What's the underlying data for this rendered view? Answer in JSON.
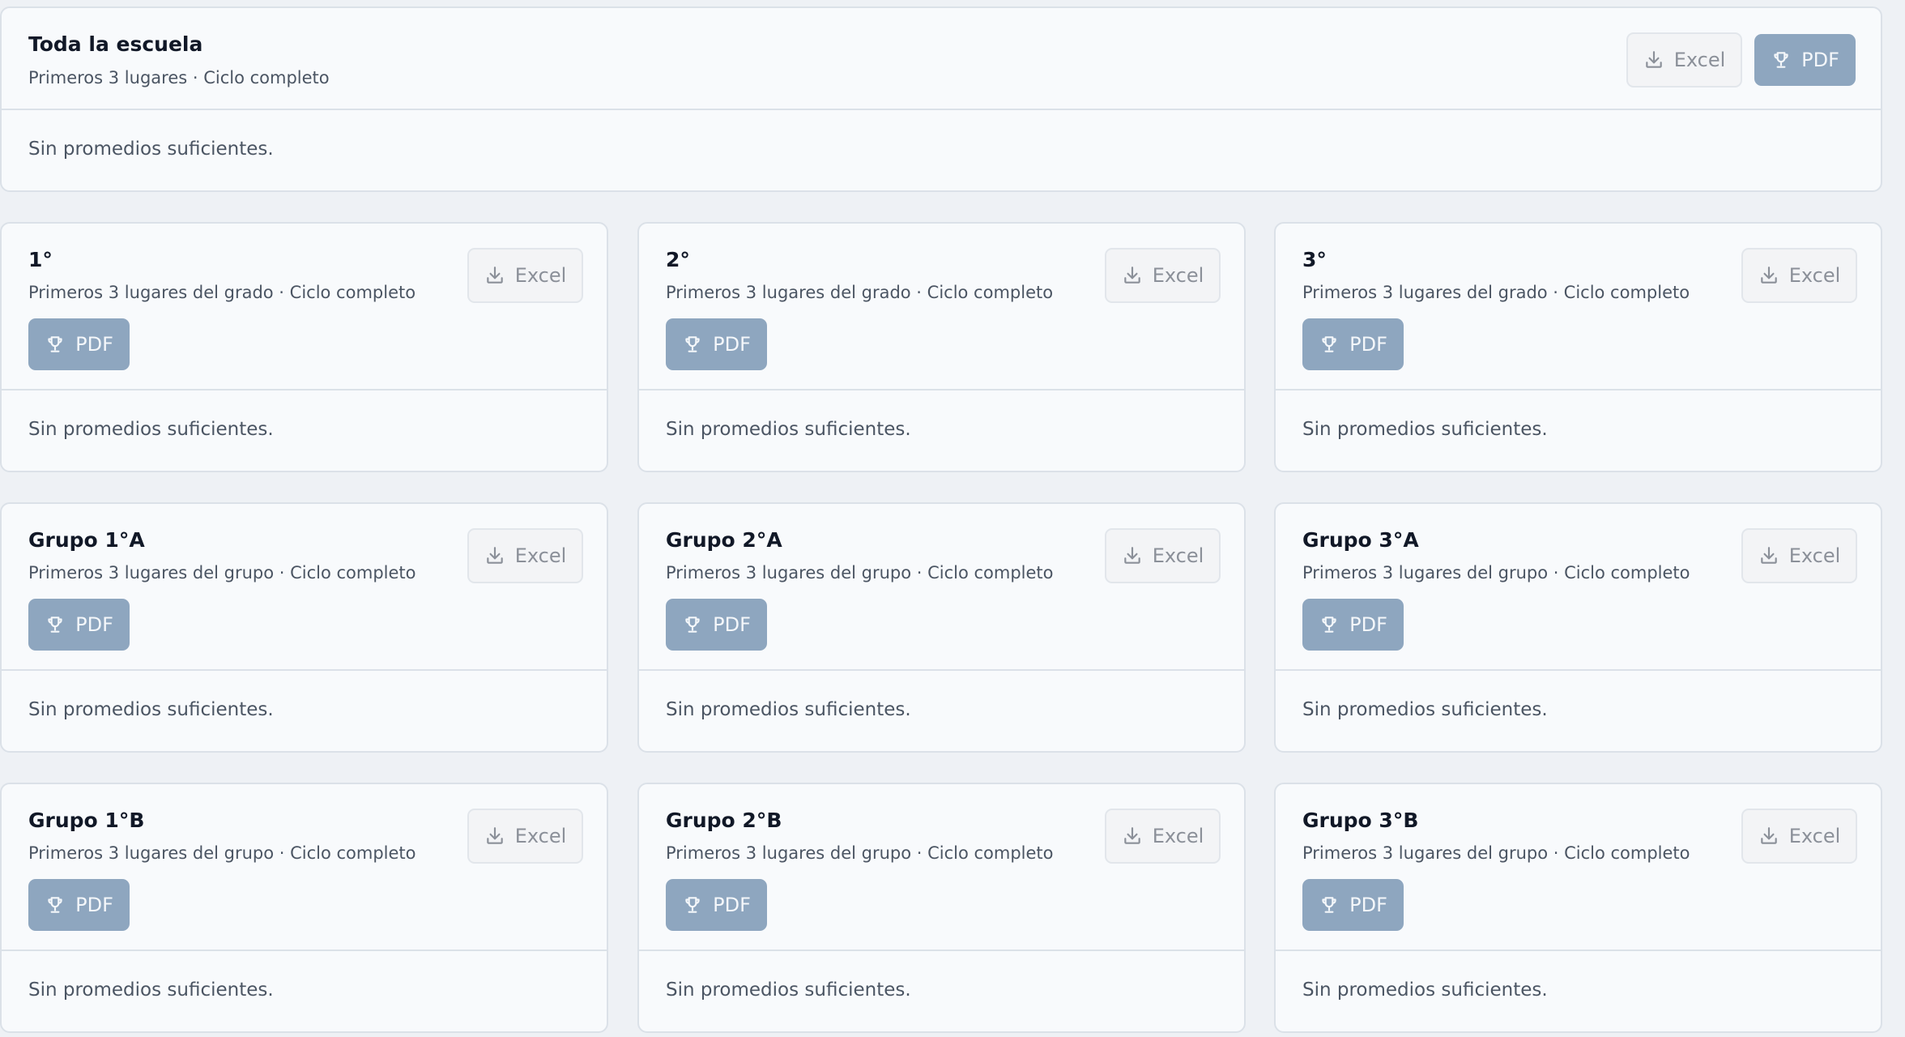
{
  "school": {
    "title": "Toda la escuela",
    "subtitle": "Primeros 3 lugares · Ciclo completo",
    "excel_label": "Excel",
    "pdf_label": "PDF",
    "empty_text": "Sin promedios suficientes."
  },
  "grades": [
    {
      "title": "1°",
      "subtitle": "Primeros 3 lugares del grado · Ciclo completo",
      "excel_label": "Excel",
      "pdf_label": "PDF",
      "empty_text": "Sin promedios suficientes."
    },
    {
      "title": "2°",
      "subtitle": "Primeros 3 lugares del grado · Ciclo completo",
      "excel_label": "Excel",
      "pdf_label": "PDF",
      "empty_text": "Sin promedios suficientes."
    },
    {
      "title": "3°",
      "subtitle": "Primeros 3 lugares del grado · Ciclo completo",
      "excel_label": "Excel",
      "pdf_label": "PDF",
      "empty_text": "Sin promedios suficientes."
    }
  ],
  "groups_a": [
    {
      "title": "Grupo 1°A",
      "subtitle": "Primeros 3 lugares del grupo · Ciclo completo",
      "excel_label": "Excel",
      "pdf_label": "PDF",
      "empty_text": "Sin promedios suficientes."
    },
    {
      "title": "Grupo 2°A",
      "subtitle": "Primeros 3 lugares del grupo · Ciclo completo",
      "excel_label": "Excel",
      "pdf_label": "PDF",
      "empty_text": "Sin promedios suficientes."
    },
    {
      "title": "Grupo 3°A",
      "subtitle": "Primeros 3 lugares del grupo · Ciclo completo",
      "excel_label": "Excel",
      "pdf_label": "PDF",
      "empty_text": "Sin promedios suficientes."
    }
  ],
  "groups_b": [
    {
      "title": "Grupo 1°B",
      "subtitle": "Primeros 3 lugares del grupo · Ciclo completo",
      "excel_label": "Excel",
      "pdf_label": "PDF",
      "empty_text": "Sin promedios suficientes."
    },
    {
      "title": "Grupo 2°B",
      "subtitle": "Primeros 3 lugares del grupo · Ciclo completo",
      "excel_label": "Excel",
      "pdf_label": "PDF",
      "empty_text": "Sin promedios suficientes."
    },
    {
      "title": "Grupo 3°B",
      "subtitle": "Primeros 3 lugares del grupo · Ciclo completo",
      "excel_label": "Excel",
      "pdf_label": "PDF",
      "empty_text": "Sin promedios suficientes."
    }
  ],
  "icons": {
    "excel": "download-icon",
    "pdf": "trophy-icon"
  },
  "colors": {
    "pdf_button": "#8ea6bf",
    "excel_button": "#f3f4f6",
    "page_background": "#eef1f5",
    "card_background": "#f8fafc"
  }
}
